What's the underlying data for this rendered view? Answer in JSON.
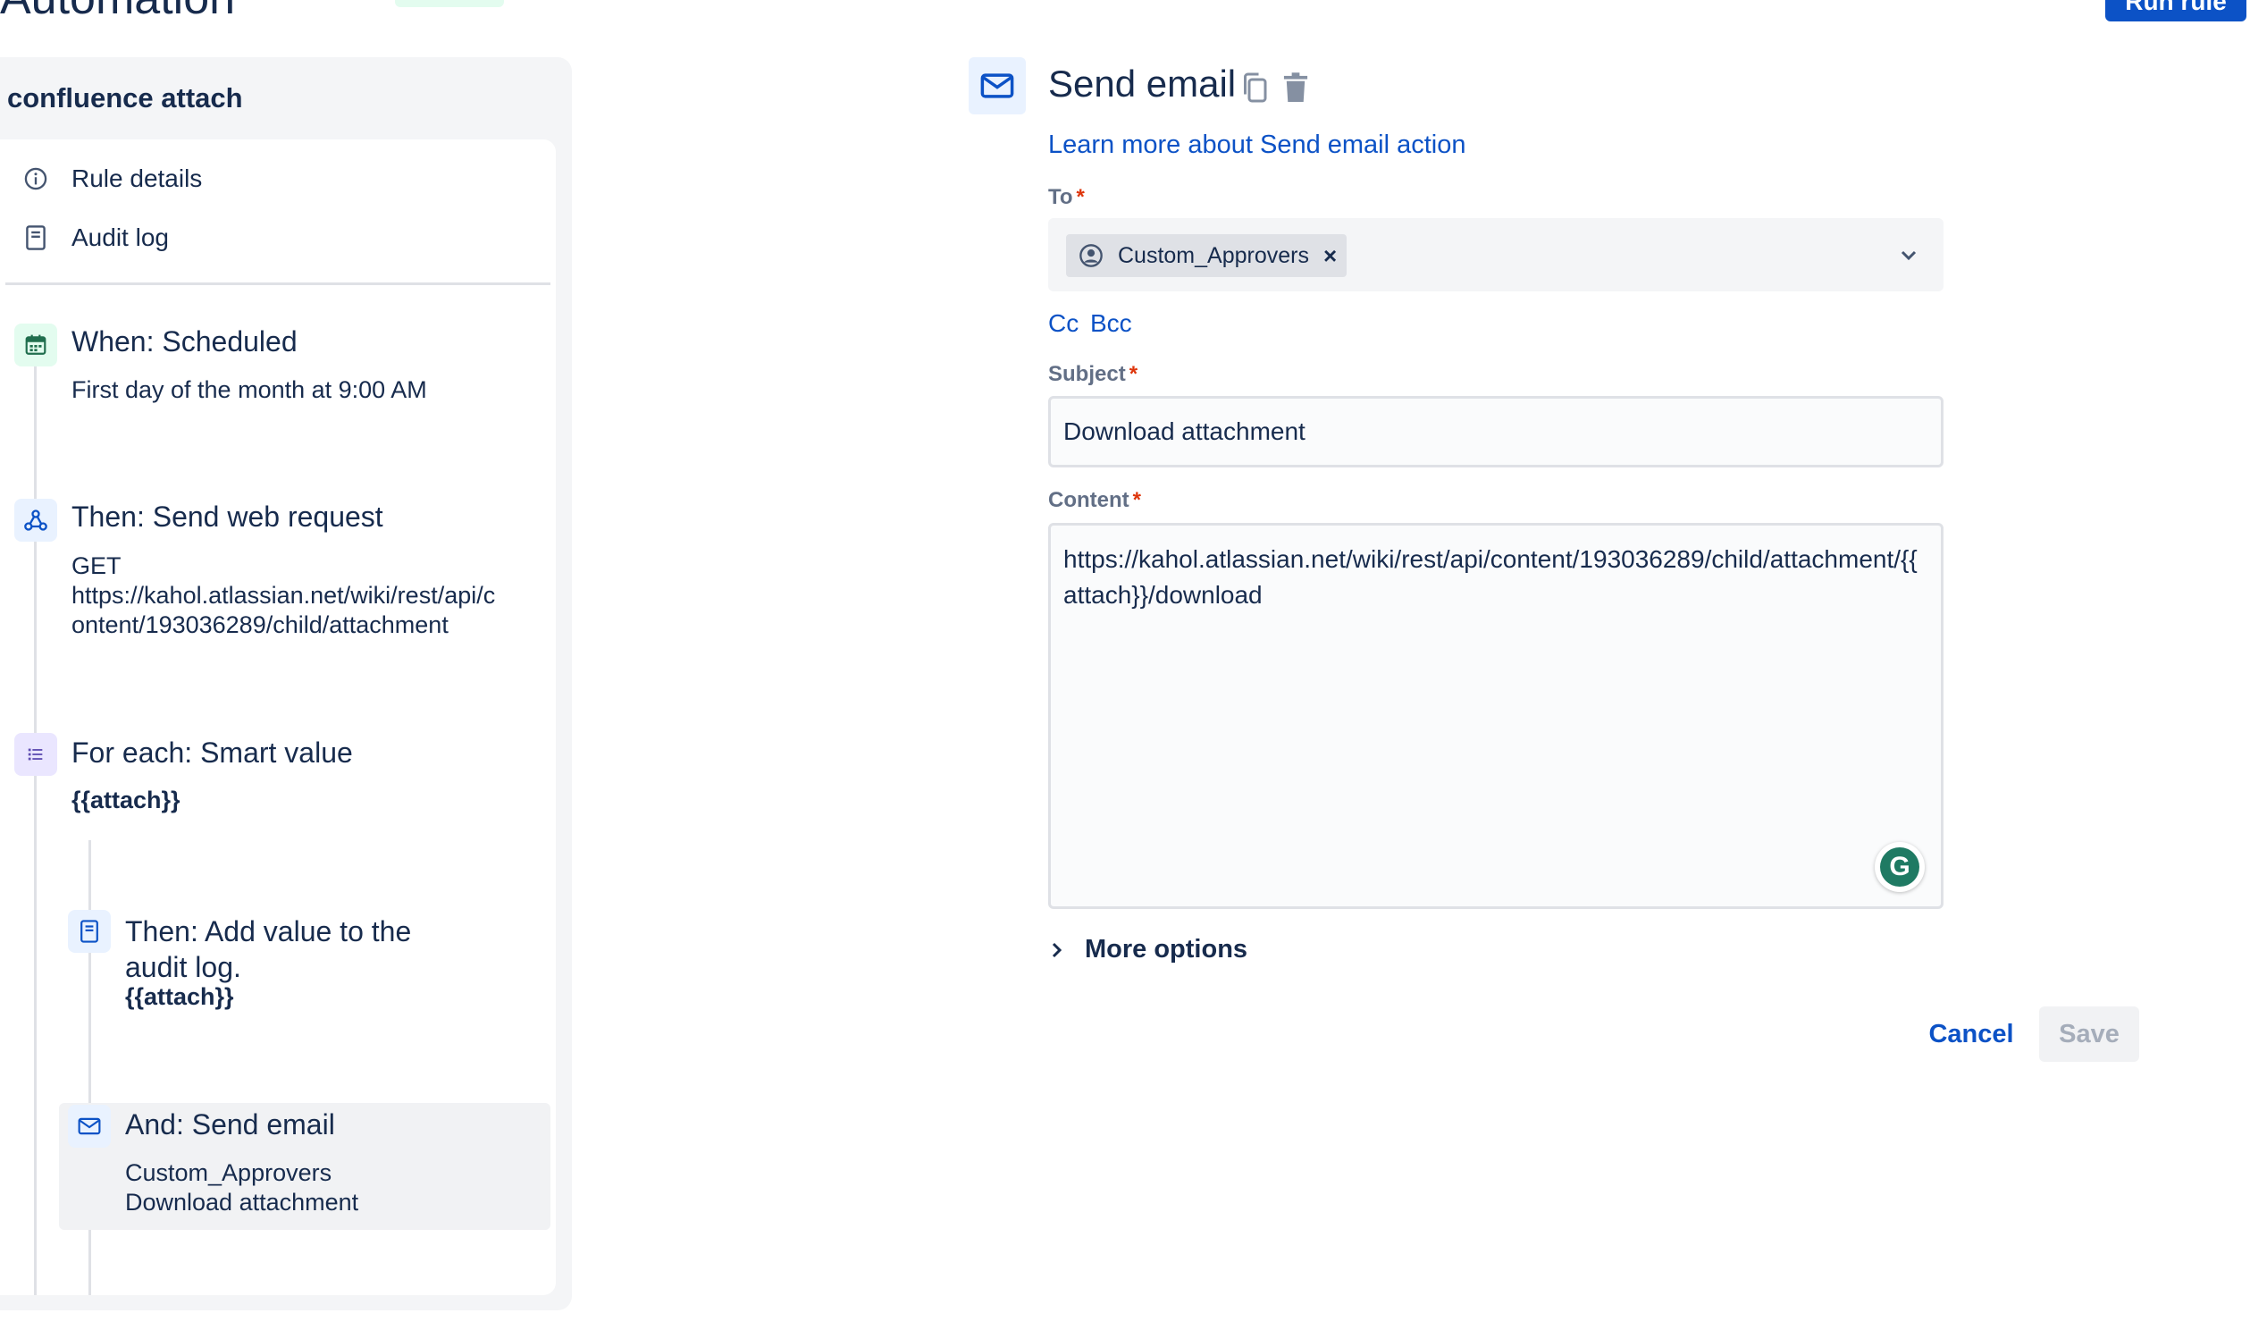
{
  "header": {
    "app_title": "Automation",
    "run_rule_label": "Run rule"
  },
  "sidebar": {
    "rule_name": "confluence attach",
    "nav": [
      {
        "label": "Rule details",
        "icon": "info-icon"
      },
      {
        "label": "Audit log",
        "icon": "document-icon"
      }
    ],
    "steps": [
      {
        "title": "When: Scheduled",
        "detail": "First day of the month at 9:00 AM",
        "icon": "calendar-icon"
      },
      {
        "title": "Then: Send web request",
        "detail_lines": [
          "GET",
          "https://kahol.atlassian.net/wiki/rest/api/c",
          "ontent/193036289/child/attachment"
        ],
        "icon": "webhook-icon"
      },
      {
        "title": "For each: Smart value",
        "detail": "{{attach}}",
        "icon": "list-icon"
      },
      {
        "title_lines": [
          "Then: Add value to the",
          "audit log."
        ],
        "detail": "{{attach}}",
        "icon": "document-icon"
      },
      {
        "title": "And: Send email",
        "detail_lines": [
          "Custom_Approvers",
          "Download attachment"
        ],
        "icon": "mail-icon",
        "selected": true
      }
    ]
  },
  "form": {
    "title": "Send email",
    "learn_more": "Learn more about Send email action",
    "to_label": "To",
    "to_value": "Custom_Approvers",
    "cc_label": "Cc",
    "bcc_label": "Bcc",
    "subject_label": "Subject",
    "subject_value": "Download attachment",
    "content_label": "Content",
    "content_value": "https://kahol.atlassian.net/wiki/rest/api/content/193036289/child/attachment/{{attach}}/download",
    "more_options": "More options",
    "cancel_label": "Cancel",
    "save_label": "Save",
    "grammarly_letter": "G"
  },
  "colors": {
    "accent": "#0c52c6",
    "required": "#de350b",
    "panel_bg": "#f4f5f7",
    "text": "#172b4d"
  }
}
